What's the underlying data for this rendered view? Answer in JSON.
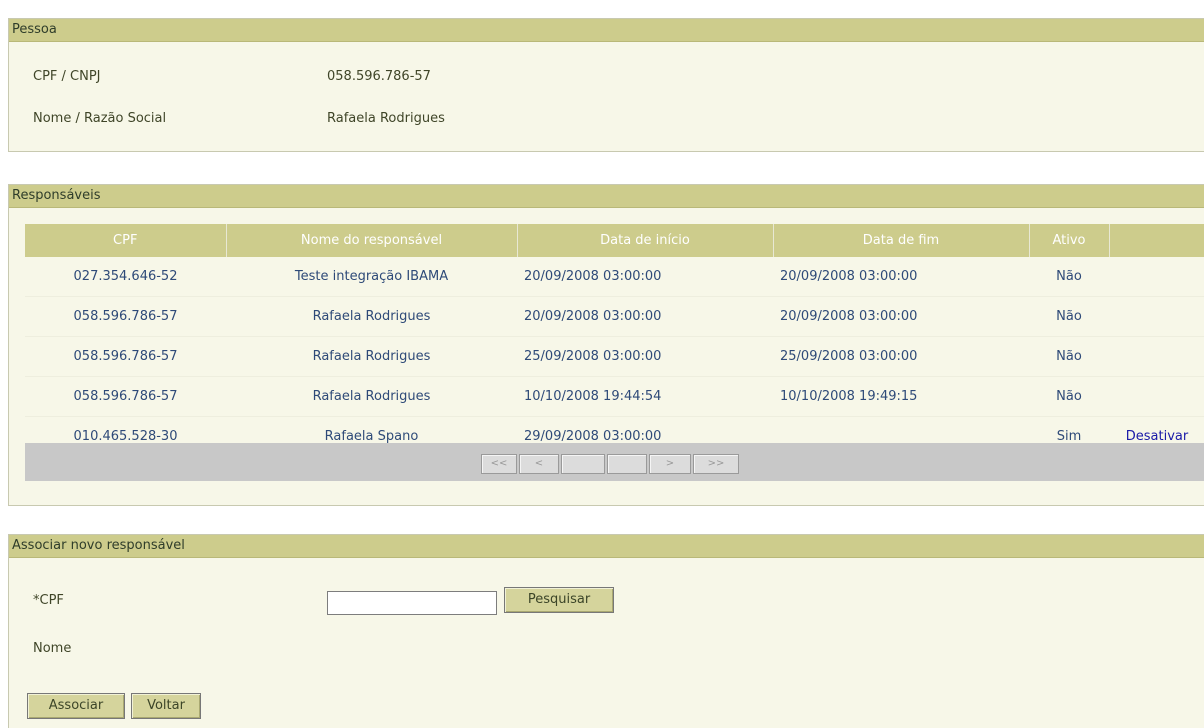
{
  "pessoa": {
    "title": "Pessoa",
    "cpf_label": "CPF / CNPJ",
    "cpf_value": "058.596.786-57",
    "nome_label": "Nome / Razão Social",
    "nome_value": "Rafaela Rodrigues"
  },
  "responsaveis": {
    "title": "Responsáveis",
    "columns": [
      "CPF",
      "Nome do responsável",
      "Data de início",
      "Data de fim",
      "Ativo",
      ""
    ],
    "rows": [
      {
        "cpf": "027.354.646-52",
        "nome": "Teste integração IBAMA",
        "inicio": "20/09/2008 03:00:00",
        "fim": "20/09/2008 03:00:00",
        "ativo": "Não",
        "acao": ""
      },
      {
        "cpf": "058.596.786-57",
        "nome": "Rafaela Rodrigues",
        "inicio": "20/09/2008 03:00:00",
        "fim": "20/09/2008 03:00:00",
        "ativo": "Não",
        "acao": ""
      },
      {
        "cpf": "058.596.786-57",
        "nome": "Rafaela Rodrigues",
        "inicio": "25/09/2008 03:00:00",
        "fim": "25/09/2008 03:00:00",
        "ativo": "Não",
        "acao": ""
      },
      {
        "cpf": "058.596.786-57",
        "nome": "Rafaela Rodrigues",
        "inicio": "10/10/2008 19:44:54",
        "fim": "10/10/2008 19:49:15",
        "ativo": "Não",
        "acao": ""
      },
      {
        "cpf": "010.465.528-30",
        "nome": "Rafaela Spano",
        "inicio": "29/09/2008 03:00:00",
        "fim": "",
        "ativo": "Sim",
        "acao": "Desativar"
      }
    ],
    "pager": {
      "first": "<<",
      "prev": "<",
      "next": ">",
      "last": ">>"
    }
  },
  "associar": {
    "title": "Associar novo responsável",
    "cpf_label": "*CPF",
    "cpf_value": "",
    "pesquisar_label": "Pesquisar",
    "nome_label": "Nome",
    "associar_label": "Associar",
    "voltar_label": "Voltar"
  }
}
